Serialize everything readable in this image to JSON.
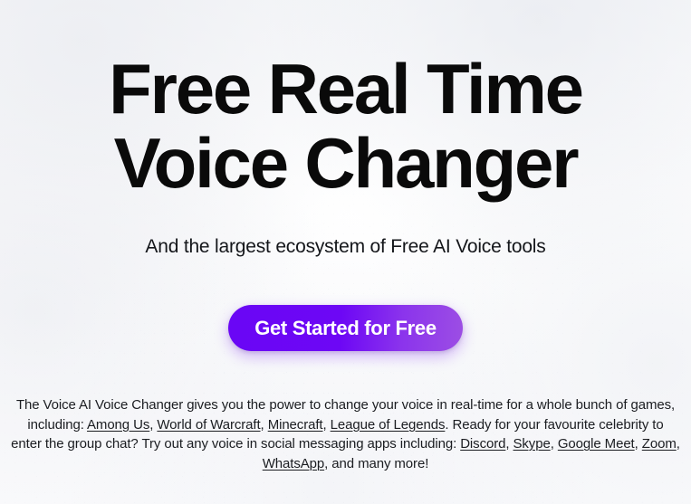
{
  "hero": {
    "headline": "Free Real Time\nVoice Changer",
    "subtitle": "And the largest ecosystem of Free AI Voice tools",
    "cta_label": "Get Started for Free",
    "accent_color_start": "#6A06F5",
    "accent_color_end": "#9C4EE4",
    "background_color": "#FBFBFC",
    "text_color": "#0A0A0A"
  },
  "blurb": {
    "seg1": "The Voice AI Voice Changer gives you the power to change your voice in real-time for a whole bunch of games, including: ",
    "link_among_us": "Among Us",
    "sep1": ", ",
    "link_world_of_warcraft": "World of Warcraft",
    "sep2": ", ",
    "link_minecraft": "Minecraft",
    "sep3": ", ",
    "link_league_of_legends": "League of Legends",
    "seg2": ". Ready for your favourite celebrity to enter the group chat? Try out any voice in social messaging apps including: ",
    "link_discord": "Discord",
    "sep4": ", ",
    "link_skype": "Skype",
    "sep5": ", ",
    "link_google_meet": "Google Meet",
    "sep6": ", ",
    "link_zoom": "Zoom",
    "sep7": ", ",
    "link_whatsapp": "WhatsApp",
    "seg3": ", and many more!"
  }
}
